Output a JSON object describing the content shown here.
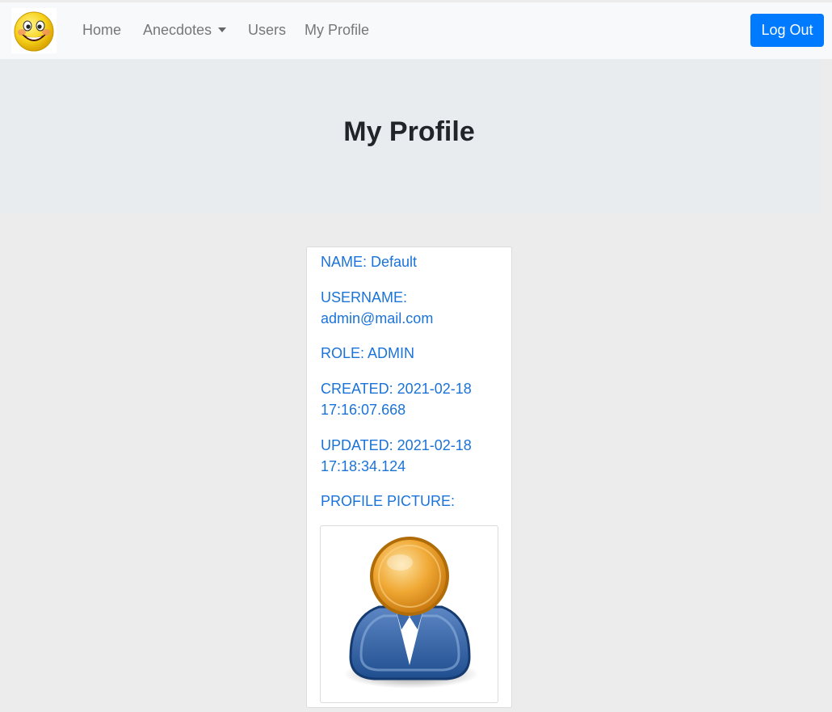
{
  "colors": {
    "navbar_bg": "#f8f9fa",
    "jumbotron_bg": "#e9ecef",
    "page_bg": "#ececec",
    "accent": "#007bff",
    "field_text": "#1a73d9"
  },
  "navbar": {
    "logo_icon": "smiley-face-icon",
    "links": {
      "home": "Home",
      "anecdotes": "Anecdotes",
      "users": "Users",
      "my_profile": "My Profile"
    },
    "logout_label": "Log Out"
  },
  "header": {
    "title": "My Profile"
  },
  "profile": {
    "name": "NAME: Default",
    "username": "USERNAME: admin@mail.com",
    "role": "ROLE: ADMIN",
    "created": "CREATED: 2021-02-18 17:16:07.668",
    "updated": "UPDATED: 2021-02-18 17:18:34.124",
    "picture_label": "PROFILE PICTURE:",
    "picture_icon": "default-user-avatar-icon"
  }
}
